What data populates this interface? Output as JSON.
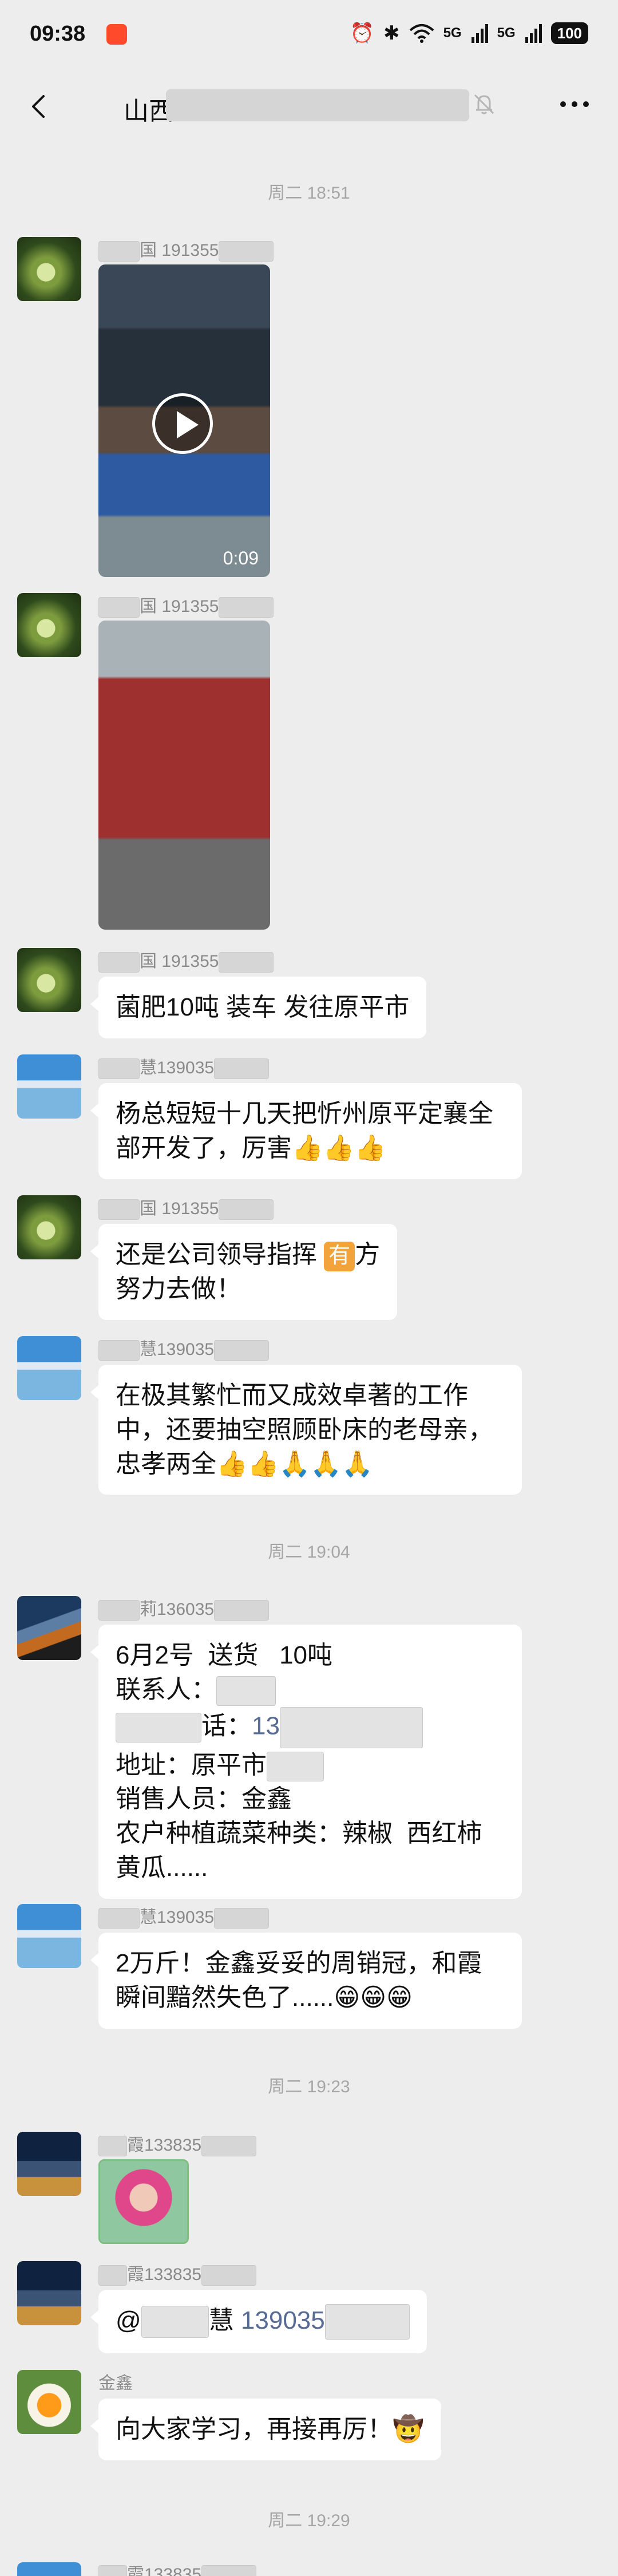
{
  "status_bar": {
    "time": "09:38",
    "alarm_icon": "⏰",
    "bluetooth_icon": "✱",
    "wifi_icon": "wifi-icon",
    "network_1": "5G",
    "network_2": "5G",
    "battery": "100"
  },
  "header": {
    "title": "山西",
    "back_icon": "back-arrow-icon",
    "mute_icon": "bell-off-icon",
    "more_icon": "more-dots-icon"
  },
  "timestamps": {
    "t1": "周二 18:51",
    "t2": "周二 19:04",
    "t3": "周二 19:23",
    "t4": "周二 19:29"
  },
  "messages": {
    "m1": {
      "sender_prefix": "",
      "sender_char": "国",
      "sender_phone": "191355",
      "type": "video",
      "duration": "0:09"
    },
    "m2": {
      "sender_char": "国",
      "sender_phone": "191355",
      "type": "image"
    },
    "m3": {
      "sender_char": "国",
      "sender_phone": "191355",
      "text": "菌肥10吨 装车 发往原平市"
    },
    "m4": {
      "sender_char": "慧",
      "sender_phone": "139035",
      "text_l1": "杨总短短十几天把忻州原平定襄全",
      "text_l2": "部开发了，厉害",
      "emojis": "👍👍👍"
    },
    "m5": {
      "sender_char": "国",
      "sender_phone": "191355",
      "text_l1": "还是公司领导指挥",
      "badge": "有",
      "text_l1b": "方",
      "text_l2": "努力去做！"
    },
    "m6": {
      "sender_char": "慧",
      "sender_phone": "139035",
      "text_l1": "在极其繁忙而又成效卓著的工作",
      "text_l2": "中，还要抽空照顾卧床的老母亲，",
      "text_l3": "忠孝两全",
      "emojis": "👍👍🙏🙏🙏"
    },
    "m7": {
      "sender_char": "莉",
      "sender_phone": "136035",
      "line1": "6月2号  送货   10吨",
      "line2": "联系人：",
      "line3_suffix": "话：",
      "line3_phone": "13",
      "line4": "地址：原平市",
      "line5": "销售人员：金鑫",
      "line6": "农户种植蔬菜种类：辣椒  西红柿",
      "line7": "黄瓜......"
    },
    "m8": {
      "sender_char": "慧",
      "sender_phone": "139035",
      "text_l1": "2万斤！金鑫妥妥的周销冠，和霞",
      "text_l2": "瞬间黯然失色了......",
      "emojis": "😁😁😁"
    },
    "m9": {
      "sender_char": "霞",
      "sender_phone": "133835",
      "type": "image"
    },
    "m10": {
      "sender_char": "霞",
      "sender_phone": "133835",
      "at": "@",
      "at_name": "慧",
      "at_phone": "139035"
    },
    "m11": {
      "sender": "金鑫",
      "text": "向大家学习，再接再厉！",
      "emoji": "🤠"
    },
    "m12": {
      "sender_char": "霞",
      "sender_phone": "133835"
    }
  }
}
